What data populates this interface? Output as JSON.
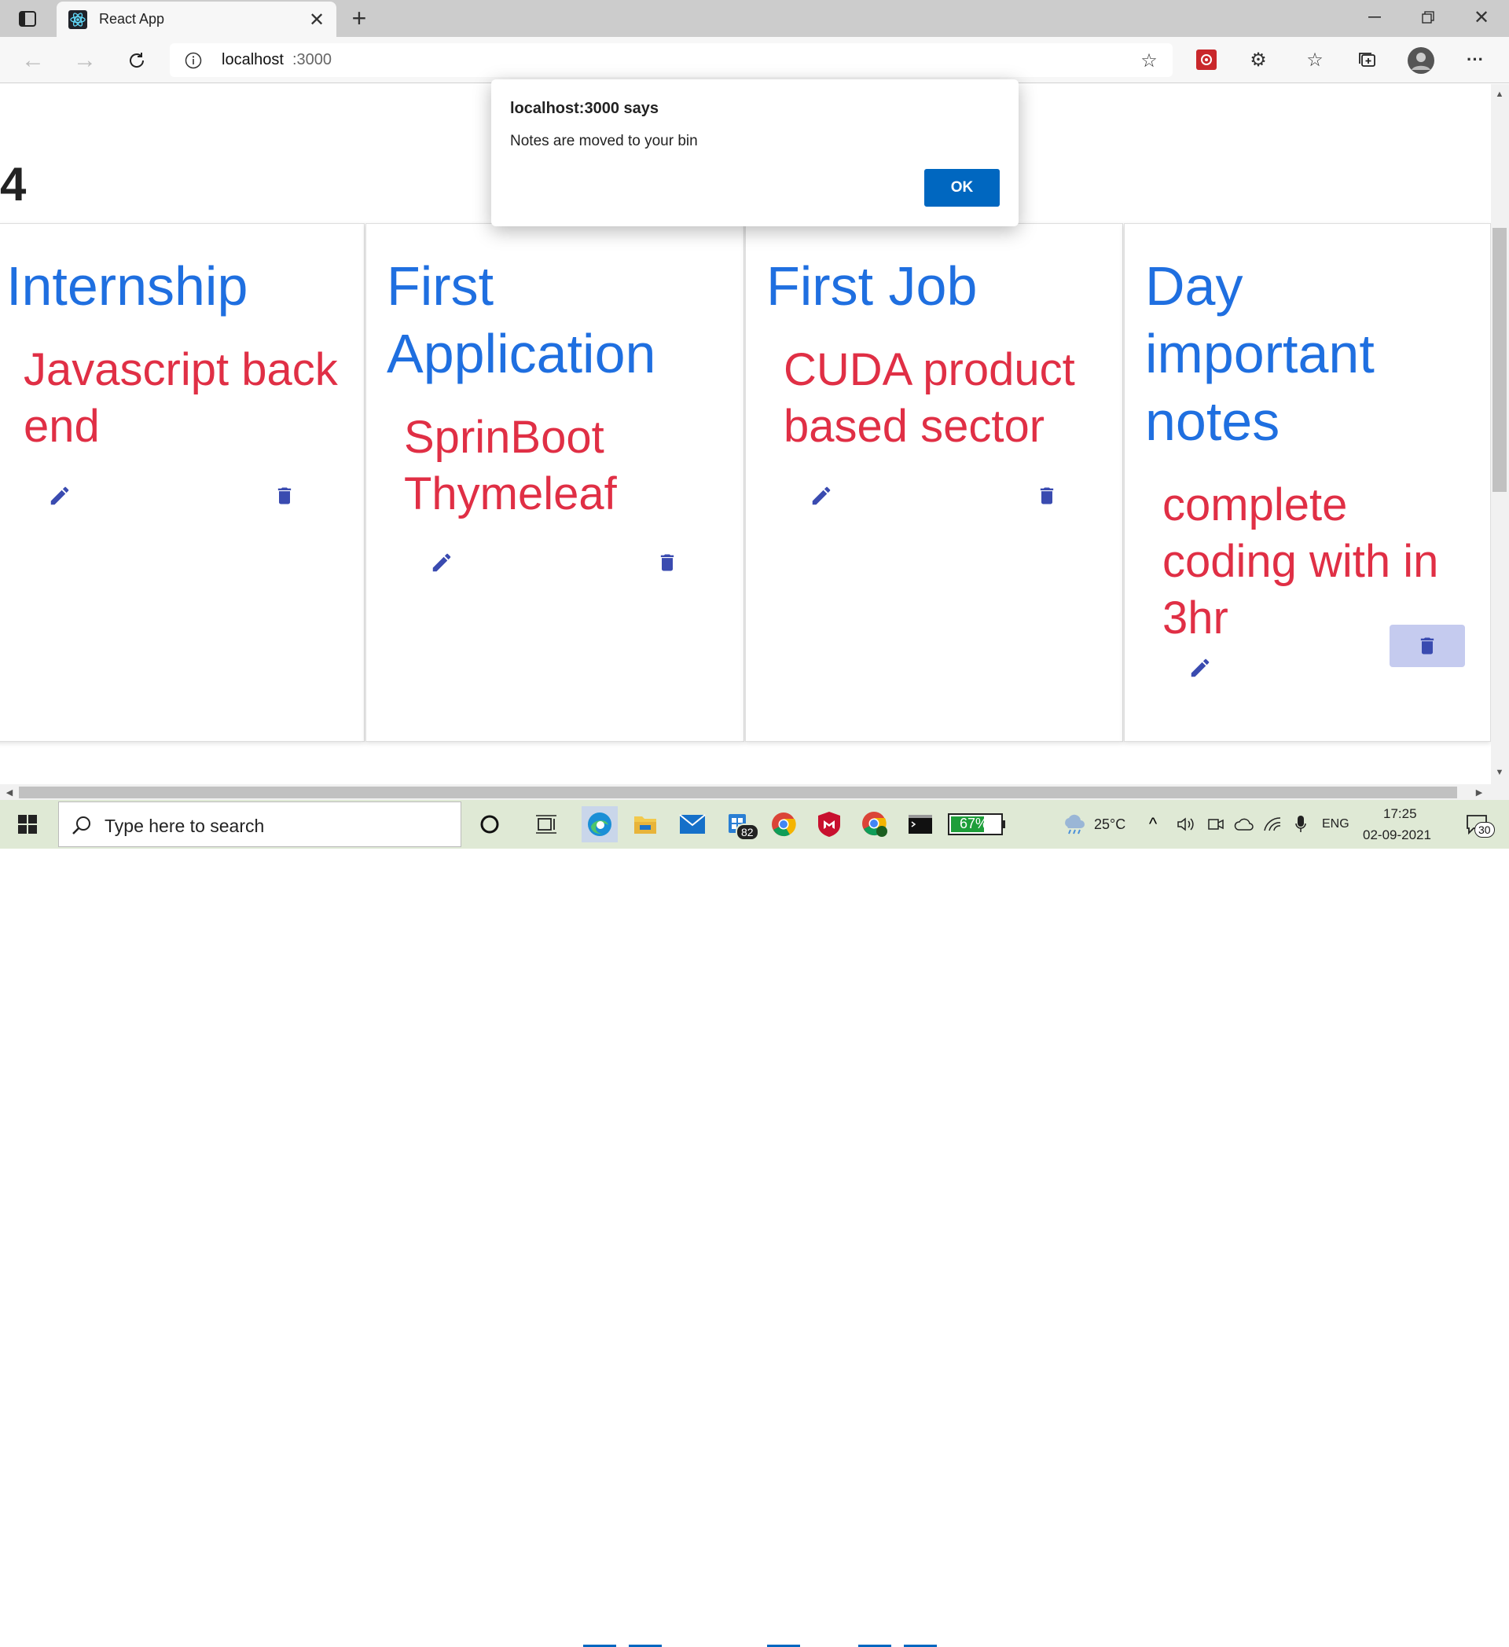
{
  "browser": {
    "tab_title": "React App",
    "address": "localhost:3000",
    "address_host": "localhost",
    "address_port": ":3000"
  },
  "page": {
    "note_count": "4",
    "notes": [
      {
        "title": "Internship",
        "body": "Javascript back end"
      },
      {
        "title": "First Application",
        "body": "SprinBoot Thymeleaf"
      },
      {
        "title": "First Job",
        "body": "CUDA product based sector"
      },
      {
        "title": "Day important notes",
        "body": "complete coding with in 3hr"
      }
    ]
  },
  "dialog": {
    "title": "localhost:3000 says",
    "message": "Notes are moved to your bin",
    "ok_label": "OK"
  },
  "taskbar": {
    "search_placeholder": "Type here to search",
    "store_badge": "82",
    "battery": "67%",
    "temperature": "25°C",
    "language": "ENG",
    "time": "17:25",
    "date": "02-09-2021",
    "notification_count": "30"
  },
  "colors": {
    "title_blue": "#1f6fe0",
    "body_red": "#e02f45",
    "action_icon": "#3a4bb0",
    "dialog_button": "#0067c0"
  }
}
